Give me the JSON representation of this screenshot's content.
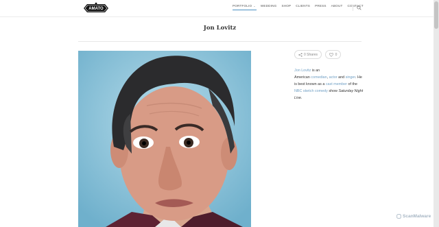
{
  "header": {
    "logo_text": "AMATO",
    "nav": [
      {
        "label": "PORTFOLIO"
      },
      {
        "label": "WEDDING"
      },
      {
        "label": "SHOP"
      },
      {
        "label": "CLIENTS"
      },
      {
        "label": "PRESS"
      },
      {
        "label": "ABOUT"
      },
      {
        "label": "CONTACT"
      }
    ],
    "nav_caret": "⌄",
    "accent_color": "#4a90c2"
  },
  "page": {
    "title": "Jon Lovitz"
  },
  "actions": {
    "shares_label": "0 Shares",
    "likes_count": "0",
    "share_icon": "share-icon",
    "heart_icon": "heart-icon"
  },
  "bio": {
    "name_link": "Jon Lovitz",
    "t1": " is an",
    "t2": "American ",
    "link_comedian": "comedian",
    "t3": ", ",
    "link_actor": "actor",
    "t4": " and ",
    "link_singer": "singer",
    "t5": ". He is best known as a ",
    "link_cast": "cast member",
    "t6": " of the ",
    "link_nbc": "NBC",
    "t7": " ",
    "link_sketch": "sketch comedy",
    "t8": " show ",
    "show": "Saturday Night Live",
    "t9": ".",
    "link_color": "#6f9fc4"
  },
  "watermark": "ScanMalware"
}
